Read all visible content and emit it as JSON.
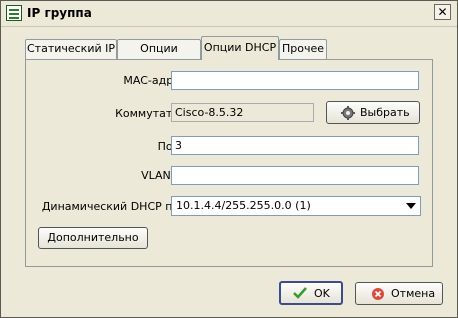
{
  "window": {
    "title": "IP группа"
  },
  "tabs": [
    {
      "label": "Статический IP"
    },
    {
      "label": "Опции RADIUS"
    },
    {
      "label": "Опции DHCP"
    },
    {
      "label": "Прочее"
    }
  ],
  "form": {
    "mac_label": "MAC-адрес",
    "mac_value": "",
    "switch_label": "Коммутатор",
    "switch_value": "Cisco-8.5.32",
    "select_button": "Выбрать",
    "port_label": "Порт",
    "port_value": "3",
    "vlan_label": "VLAN ID",
    "vlan_value": "",
    "pool_label": "Динамический DHCP пул",
    "pool_selected": "10.1.4.4/255.255.0.0 (1)",
    "advanced_button": "Дополнительно"
  },
  "footer": {
    "ok_label": "OK",
    "cancel_label": "Отмена"
  }
}
